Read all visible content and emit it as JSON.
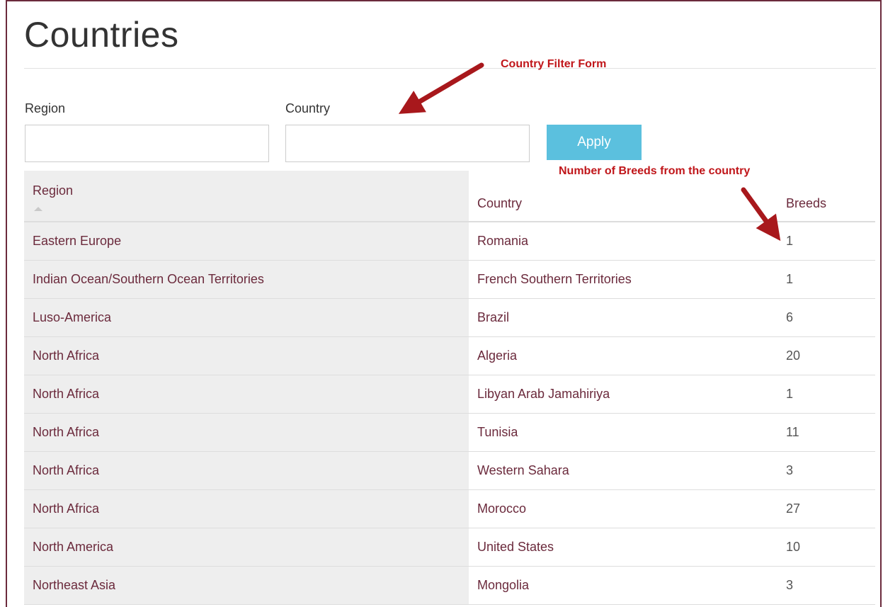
{
  "page": {
    "title": "Countries"
  },
  "filter_form": {
    "region_label": "Region",
    "country_label": "Country",
    "region_value": "",
    "country_value": "",
    "apply_label": "Apply"
  },
  "annotations": {
    "filter_form_note": "Country Filter Form",
    "breeds_note": "Number of Breeds from the country"
  },
  "colors": {
    "annotation_red": "#c0161a",
    "link_color": "#6b2a3c",
    "apply_button": "#5bc0de"
  },
  "table": {
    "headers": {
      "region": "Region",
      "country": "Country",
      "breeds": "Breeds"
    },
    "sorted_column": "region",
    "sort_direction": "ascending",
    "rows": [
      {
        "region": "Eastern Europe",
        "country": "Romania",
        "breeds": "1"
      },
      {
        "region": "Indian Ocean/Southern Ocean Territories",
        "country": "French Southern Territories",
        "breeds": "1"
      },
      {
        "region": "Luso-America",
        "country": "Brazil",
        "breeds": "6"
      },
      {
        "region": "North Africa",
        "country": "Algeria",
        "breeds": "20"
      },
      {
        "region": "North Africa",
        "country": "Libyan Arab Jamahiriya",
        "breeds": "1"
      },
      {
        "region": "North Africa",
        "country": "Tunisia",
        "breeds": "11"
      },
      {
        "region": "North Africa",
        "country": "Western Sahara",
        "breeds": "3"
      },
      {
        "region": "North Africa",
        "country": "Morocco",
        "breeds": "27"
      },
      {
        "region": "North America",
        "country": "United States",
        "breeds": "10"
      },
      {
        "region": "Northeast Asia",
        "country": "Mongolia",
        "breeds": "3"
      }
    ]
  }
}
